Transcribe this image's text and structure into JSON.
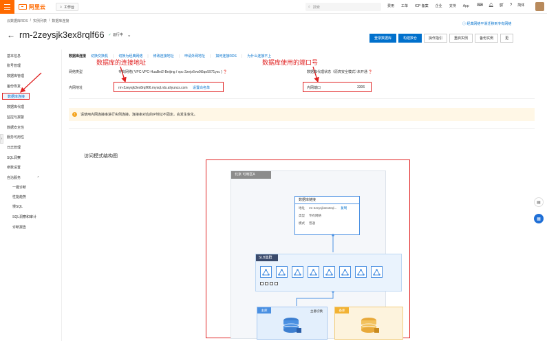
{
  "topbar": {
    "logo_text": "阿里云",
    "workbench_label": "工作台",
    "search_placeholder": "搜索",
    "nav": [
      "费用",
      "工单",
      "ICP 备案",
      "企业",
      "支持",
      "App"
    ],
    "lang": "简体"
  },
  "breadcrumb": [
    "云数据库RDS",
    "/",
    "实例列表",
    "/",
    "数据库连接"
  ],
  "instance": {
    "title": "rm-2zeysjk3ex8rqlf66",
    "status": "运行中",
    "top_right_link": "经典网络平滑迁移到专有网络"
  },
  "actions": {
    "buttons": [
      "登录数据库",
      "构建数仓",
      "操作指引",
      "重启实例",
      "备份实例",
      "更"
    ]
  },
  "sidebar": {
    "items": [
      {
        "label": "基本信息"
      },
      {
        "label": "账号管理"
      },
      {
        "label": "数据库管理"
      },
      {
        "label": "备份恢复"
      },
      {
        "label": "数据库连接"
      },
      {
        "label": "数据库代理"
      },
      {
        "label": "监控与报警"
      },
      {
        "label": "数据安全性"
      },
      {
        "label": "服务可用性"
      },
      {
        "label": "日志管理"
      },
      {
        "label": "SQL洞察"
      },
      {
        "label": "参数设置"
      },
      {
        "label": "自治服务"
      },
      {
        "label": "一键诊断"
      },
      {
        "label": "性能趋势"
      },
      {
        "label": "慢SQL"
      },
      {
        "label": "SQL洞察和审计"
      },
      {
        "label": "诊断报告"
      }
    ]
  },
  "tabs": {
    "title": "数据库连接",
    "links": [
      "切换交换机",
      "切换为经典网络",
      "修改连接地址",
      "申请外网地址",
      "如何连接RDS",
      "为什么连接不上"
    ]
  },
  "connection": {
    "network_type_label": "网络类型",
    "network_type_value": "专有网络( VPC:VPC-HuaBei2-Beijing / vpc-2zejo6vw9i5qo5971ysc )",
    "intranet_address_label": "内网地址",
    "intranet_address_value": "rm-2zeysjk3ex8rqlf66.mysql.rds.aliyuncs.com",
    "whitelist_link": "设置白名单",
    "proxy_status_label": "数据库代理状态（原高安全模式）",
    "proxy_status_value": "未开通",
    "intranet_port_label": "内网端口",
    "intranet_port_value": "3306"
  },
  "annotations": {
    "address": "数据库的连接地址",
    "port": "数据库使用的端口号"
  },
  "hint": "请使用内网连接串进行实例连接，连接串对应的IP地址不固定，会发生变化。",
  "diagram": {
    "section_title": "访问模式结构图",
    "zone": "北京 可用区A",
    "card_title": "数据库链接",
    "rows": [
      {
        "k": "地址",
        "v": "rm-2zeysjk3ex8rql...",
        "link": "复制"
      },
      {
        "k": "类型",
        "v": "专有网络",
        "link": ""
      },
      {
        "k": "模式",
        "v": "普通",
        "link": ""
      }
    ],
    "slb_label": "SLB集群",
    "primary_label": "主库",
    "standby_label": "备库",
    "switch_label": "主备切换"
  },
  "colors": {
    "brand": "#ff6a00",
    "link": "#0070cc",
    "annotation": "#e02020",
    "hint_bg": "#fff7e6"
  }
}
